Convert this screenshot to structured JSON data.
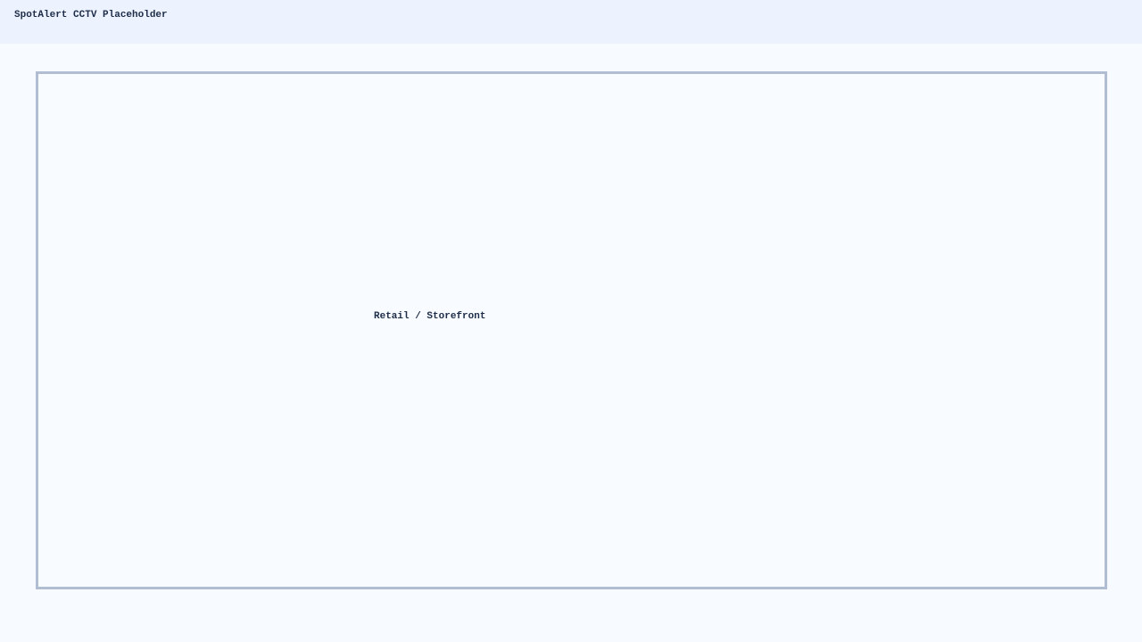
{
  "header": {
    "title": "SpotAlert CCTV Placeholder"
  },
  "camera": {
    "label": "Retail / Storefront"
  }
}
